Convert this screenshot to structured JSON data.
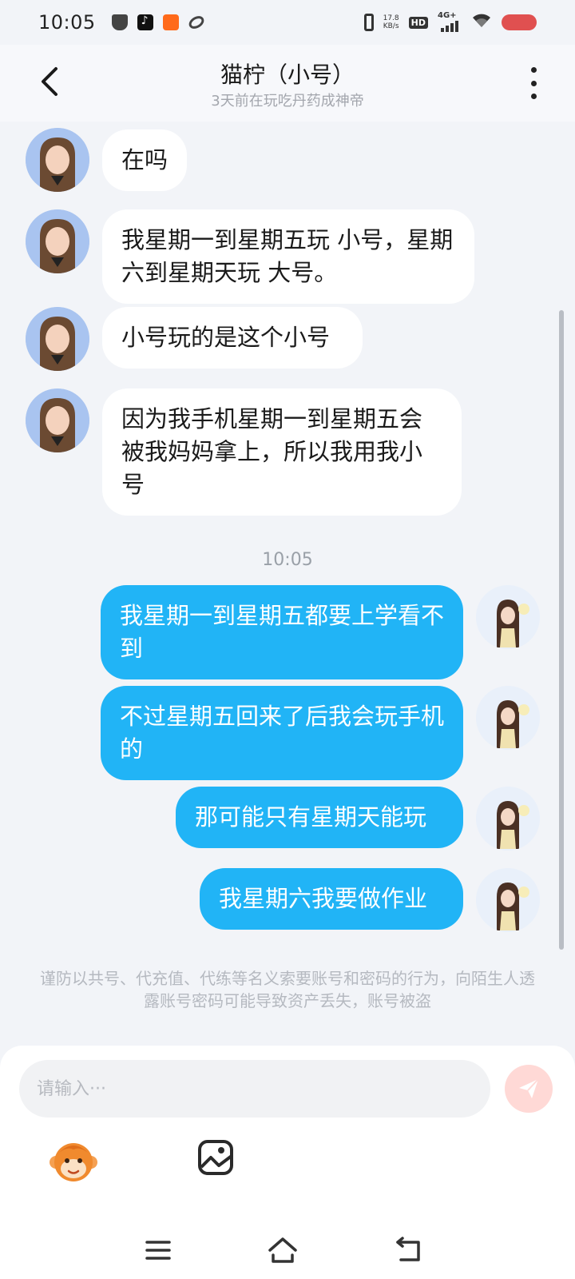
{
  "status_bar": {
    "time": "10:05",
    "net_speed_value": "17.8",
    "net_speed_unit": "KB/s",
    "hd_label": "HD",
    "signal_label": "4G+",
    "left_icons": [
      "shield-check-icon",
      "tiktok-icon",
      "kuaishou-icon",
      "link-icon"
    ]
  },
  "header": {
    "title": "猫柠（小号）",
    "subtitle": "3天前在玩吃丹药成神帝"
  },
  "messages_received": [
    {
      "text": "在吗"
    },
    {
      "text": "我星期一到星期五玩  小号，星期六到星期天玩  大号。"
    },
    {
      "text": "小号玩的是这个小号"
    },
    {
      "text": "因为我手机星期一到星期五会被我妈妈拿上，所以我用我小号"
    }
  ],
  "time_divider": "10:05",
  "messages_sent": [
    {
      "text": "我星期一到星期五都要上学看不到"
    },
    {
      "text": "不过星期五回来了后我会玩手机的"
    },
    {
      "text": "那可能只有星期天能玩"
    },
    {
      "text": "我星期六我要做作业"
    }
  ],
  "warning": "谨防以共号、代充值、代练等名义索要账号和密码的行为，向陌生人透露账号密码可能导致资产丢失，账号被盗",
  "input": {
    "placeholder": "请输入···",
    "value": ""
  },
  "colors": {
    "sent_bubble": "#21b4f6",
    "received_bubble": "#ffffff",
    "send_button": "#ffd9d6",
    "battery": "#e05050"
  }
}
